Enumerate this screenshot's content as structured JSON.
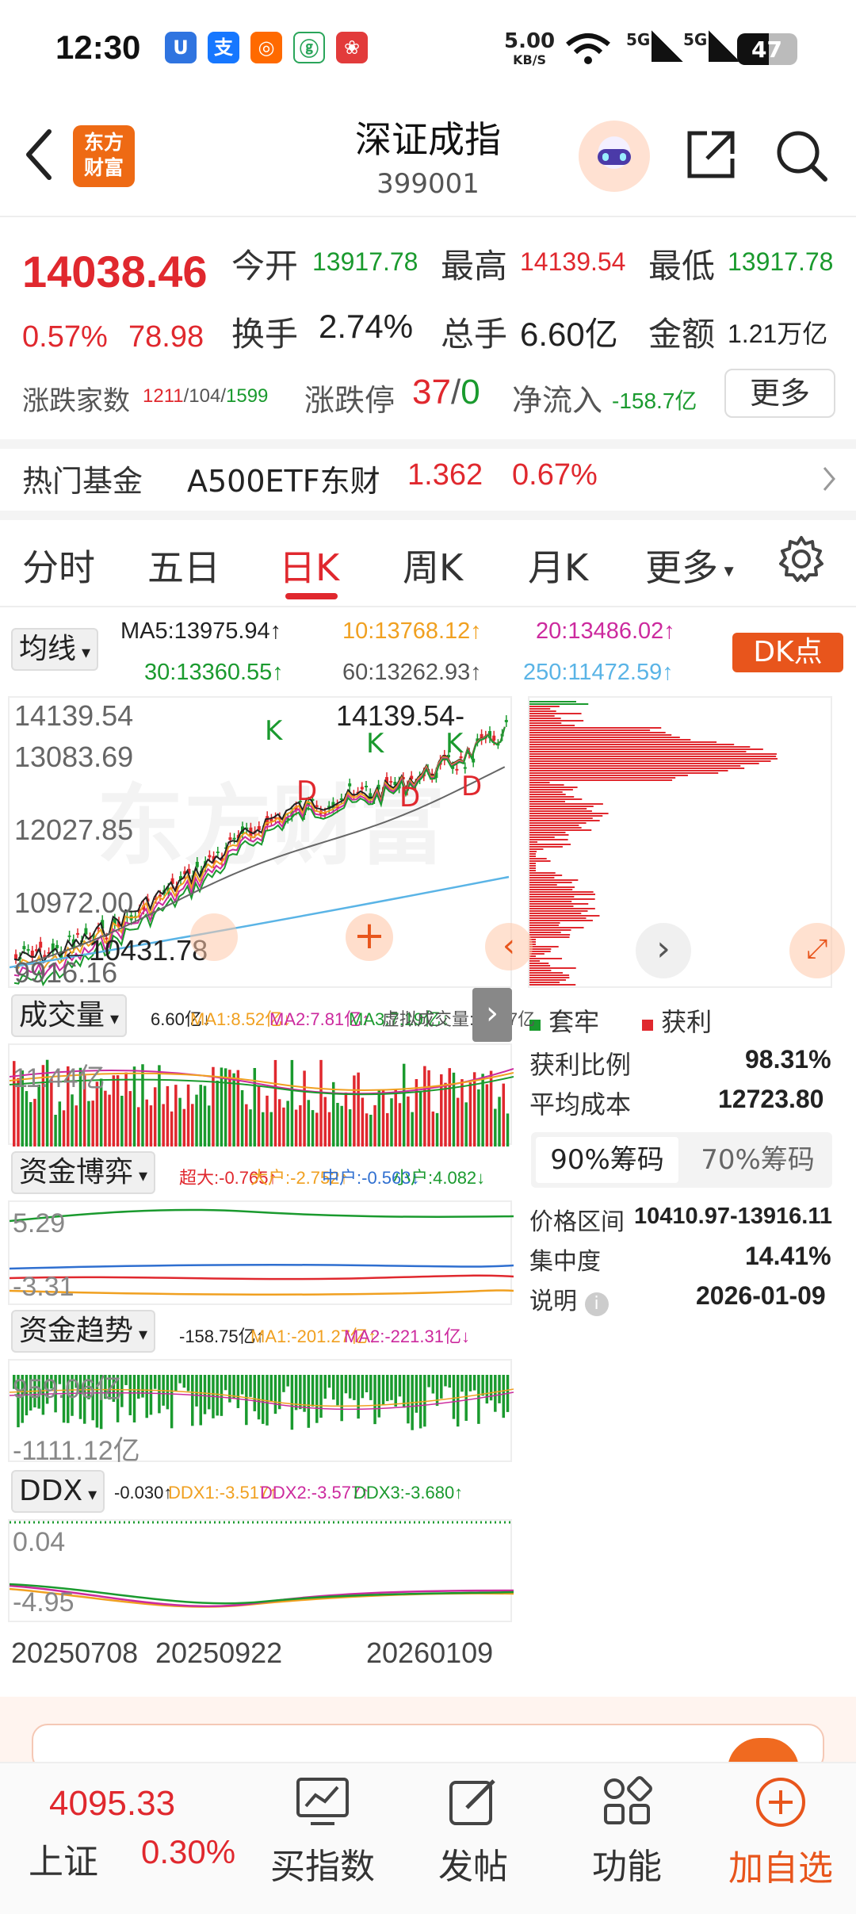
{
  "status_bar": {
    "time": "12:30",
    "net_speed": "5.00",
    "net_unit": "KB/S",
    "battery": "47"
  },
  "header": {
    "logo_text": "东方\n财富",
    "title": "深证成指",
    "code": "399001"
  },
  "quote": {
    "price": "14038.46",
    "change_pct": "0.57%",
    "change_abs": "78.98",
    "open_label": "今开",
    "open": "13917.78",
    "high_label": "最高",
    "high": "14139.54",
    "low_label": "最低",
    "low": "13917.78",
    "turnover_label": "换手",
    "turnover": "2.74%",
    "volume_label": "总手",
    "volume": "6.60亿",
    "amount_label": "金额",
    "amount": "1.21万亿",
    "breadth_label": "涨跌家数",
    "breadth_up": "1211",
    "breadth_flat": "104",
    "breadth_down": "1599",
    "limit_label": "涨跌停",
    "limit_up": "37",
    "limit_down": "0",
    "netflow_label": "净流入",
    "netflow": "-158.7亿",
    "more_button": "更多"
  },
  "hot_fund": {
    "label": "热门基金",
    "name": "A500ETF东财",
    "price": "1.362",
    "change": "0.67%"
  },
  "tabs": [
    "分时",
    "五日",
    "日K",
    "周K",
    "月K",
    "更多"
  ],
  "active_tab": "日K",
  "chart": {
    "ma_selector": "均线",
    "ma5": "MA5:13975.94↑",
    "ma10": "10:13768.12↑",
    "ma20": "20:13486.02↑",
    "ma30": "30:13360.55↑",
    "ma60": "60:13262.93↑",
    "ma250": "250:11472.59↑",
    "dk_button": "DK点",
    "price_axis": [
      "14139.54",
      "13083.69",
      "12027.85",
      "10972.00",
      "9916.16"
    ],
    "high_marker": "14139.54",
    "low_marker": "10431.78",
    "k_marks": [
      "K",
      "K",
      "K"
    ],
    "d_marks": [
      "D",
      "D",
      "D"
    ],
    "volume_panel": {
      "label": "成交量",
      "values": "6.60亿↓",
      "ma1": "MA1:8.52亿↓",
      "ma2": "MA2:7.81亿↑",
      "ma3": "MA3:7.19亿↓",
      "virtual": "虚拟成交量:10.07亿",
      "axis": "11.44亿"
    },
    "capital_game": {
      "label": "资金博弈",
      "super": "超大:-0.765↑",
      "large": "大户:-2.752↑",
      "medium": "中户:-0.563↓",
      "small": "小户:4.082↓",
      "axis_top": "5.29",
      "axis_bottom": "-3.31"
    },
    "capital_trend": {
      "label": "资金趋势",
      "value": "-158.75亿↑",
      "ma1": "MA1:-201.27亿↑",
      "ma2": "MA2:-221.31亿↓",
      "axis_top": "959.06亿",
      "axis_bottom": "-1111.12亿"
    },
    "ddx": {
      "label": "DDX",
      "value": "-0.030↑",
      "ddx1": "DDX1:-3.517↑",
      "ddx2": "DDX2:-3.577↑",
      "ddx3": "DDX3:-3.680↑",
      "axis_top": "0.04",
      "axis_bottom": "-4.95"
    },
    "dates": [
      "20250708",
      "20250922",
      "20260109"
    ]
  },
  "chip_distribution": {
    "legend_loss": "套牢",
    "legend_profit": "获利",
    "profit_ratio_label": "获利比例",
    "profit_ratio": "98.31%",
    "avg_cost_label": "平均成本",
    "avg_cost": "12723.80",
    "tab_90": "90%筹码",
    "tab_70": "70%筹码",
    "range_label": "价格区间",
    "range": "10410.97-13916.11",
    "concentration_label": "集中度",
    "concentration": "14.41%",
    "note_label": "说明",
    "note_date": "2026-01-09"
  },
  "bottom_bar": {
    "index_price": "4095.33",
    "index_name": "上证",
    "index_change": "0.30%",
    "items": [
      "买指数",
      "发帖",
      "功能",
      "加自选"
    ]
  },
  "colors": {
    "red": "#e0282e",
    "green": "#1a9a2e",
    "accent": "#ee6a14"
  }
}
